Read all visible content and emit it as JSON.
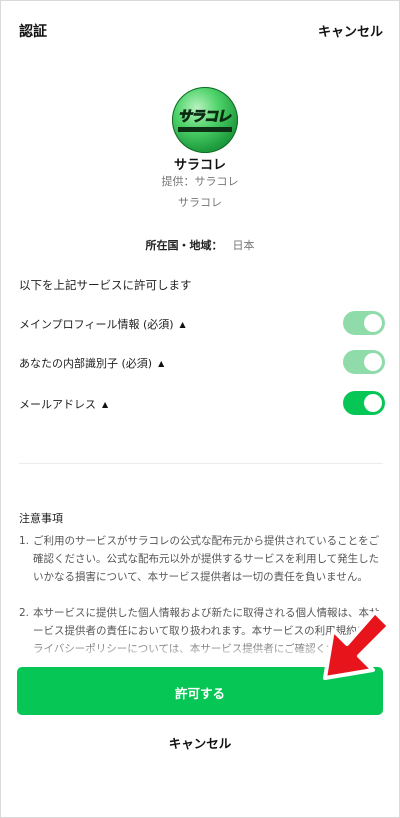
{
  "header": {
    "title": "認証",
    "cancel_label": "キャンセル"
  },
  "service": {
    "logo_text": "サラコレ",
    "name": "サラコレ",
    "provider_label": "提供：サラコレ",
    "provider_name": "サラコレ"
  },
  "region": {
    "label": "所在国・地域：",
    "value": "日本"
  },
  "permissions": {
    "heading": "以下を上記サービスに許可します",
    "items": [
      {
        "label": "メインプロフィール情報 (必須)",
        "state": "on",
        "color": "#8fdcaa"
      },
      {
        "label": "あなたの内部識別子 (必須)",
        "state": "on",
        "color": "#8fdcaa"
      },
      {
        "label": "メールアドレス",
        "state": "on",
        "color": "#06c755"
      }
    ]
  },
  "notes": {
    "title": "注意事項",
    "items": [
      {
        "number": "1.",
        "text": "ご利用のサービスがサラコレの公式な配布元から提供されていることをご確認ください。公式な配布元以外が提供するサービスを利用して発生したいかなる損害について、本サービス提供者は一切の責任を負いません。"
      },
      {
        "number": "2.",
        "text": "本サービスに提供した個人情報および新たに取得される個人情報は、本サービス提供者の責任において取り扱われます。本サービスの利用規約やプライバシーポリシーについては、本サービス提供者にご確認ください。"
      }
    ]
  },
  "actions": {
    "allow_label": "許可する",
    "cancel_label": "キャンセル"
  },
  "colors": {
    "accent": "#06c755",
    "arrow": "#e8141c"
  }
}
